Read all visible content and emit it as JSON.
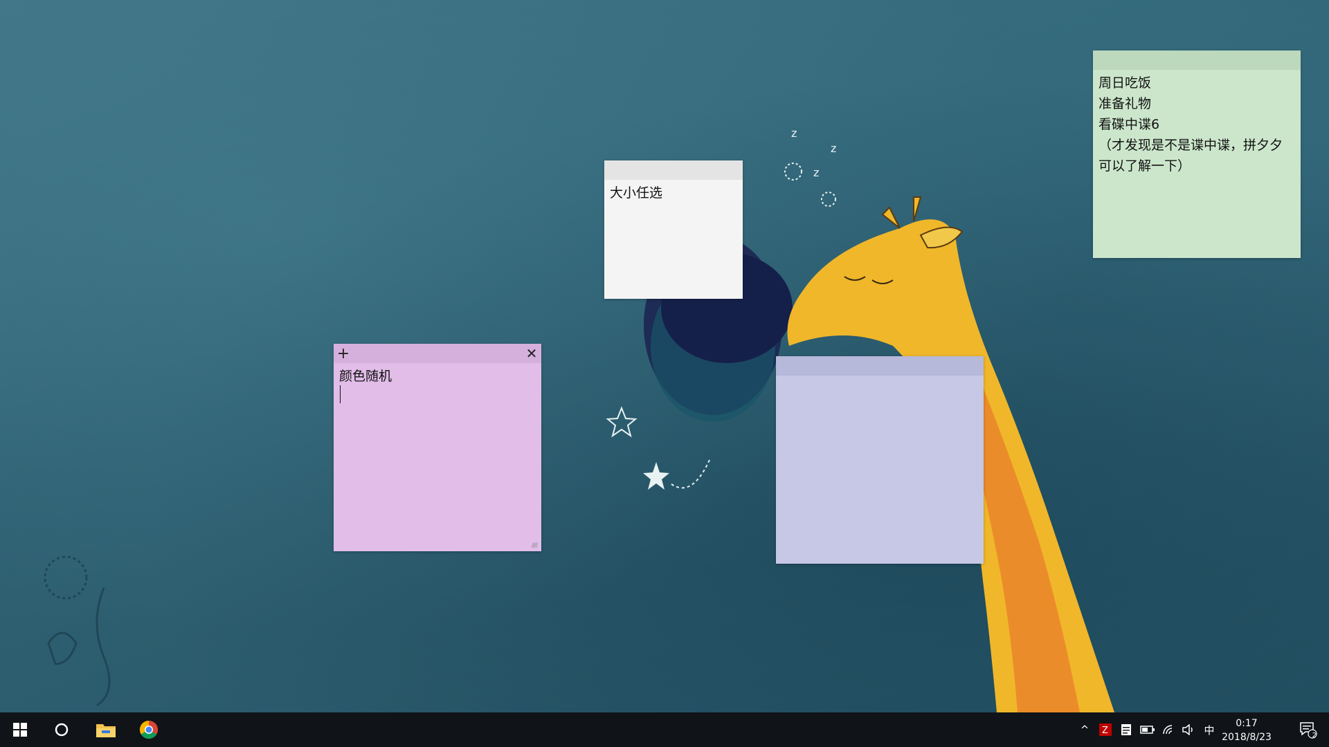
{
  "notes": {
    "purple": {
      "color": "#e1bde8",
      "header_color": "#d6b0dd",
      "text": "颜色随机",
      "add_symbol": "+",
      "close_symbol": "✕",
      "grip_text": "////"
    },
    "white": {
      "color": "#f4f4f4",
      "header_color": "#e4e4e4",
      "text": "大小任选"
    },
    "green": {
      "color": "#cce6cc",
      "header_color": "#bcd9bd",
      "lines": [
        "周日吃饭",
        "准备礼物",
        "看碟中谍6",
        "（才发现是不是谍中谍，拼夕夕",
        "可以了解一下）"
      ]
    },
    "blue": {
      "color": "#c6c8e6",
      "header_color": "#b6b9da",
      "text": ""
    }
  },
  "taskbar": {
    "background": "#101418",
    "pinned": [
      {
        "name": "start-button",
        "icon": "windows-icon"
      },
      {
        "name": "cortana-button",
        "icon": "circle-icon"
      },
      {
        "name": "file-explorer-button",
        "icon": "folder-icon"
      },
      {
        "name": "chrome-button",
        "icon": "chrome-icon"
      }
    ],
    "tray": {
      "overflow_symbol": "^",
      "ime_label": "中",
      "time": "0:17",
      "date": "2018/8/23",
      "notification_count": "2"
    }
  }
}
